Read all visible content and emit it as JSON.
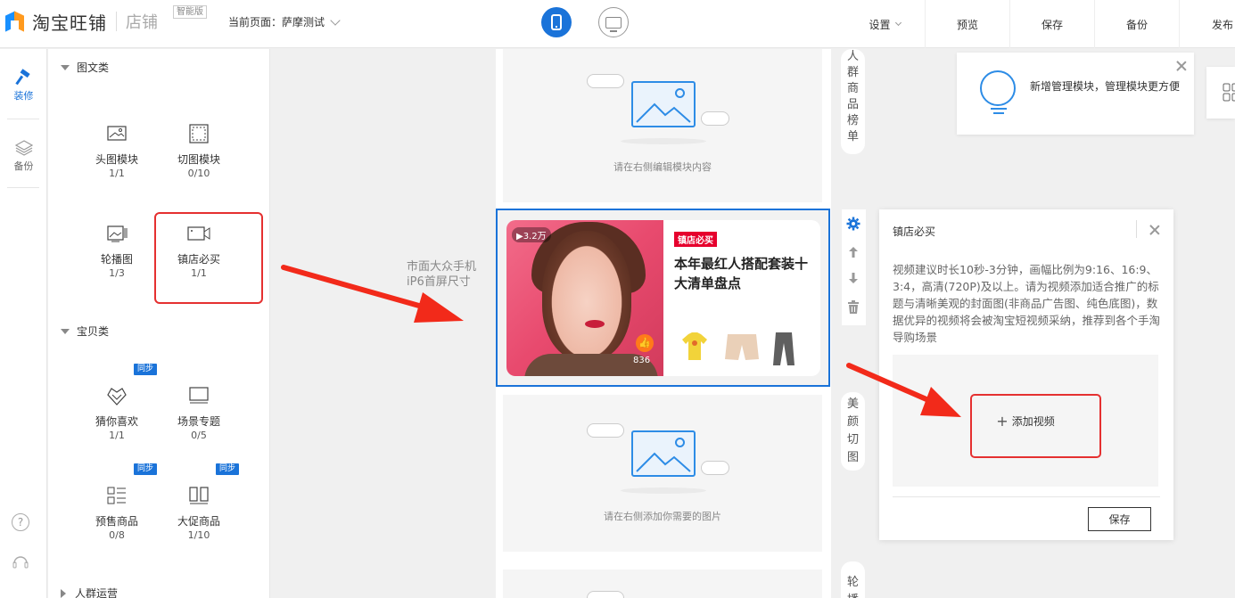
{
  "header": {
    "logo_text": "淘宝旺铺",
    "logo_sub": "店铺",
    "logo_badge": "智能版",
    "current_page_label": "当前页面：",
    "current_page_value": "萨摩测试",
    "actions": [
      "设置",
      "预览",
      "保存",
      "备份",
      "发布"
    ]
  },
  "leftnav": {
    "items": [
      {
        "label": "装修",
        "icon": "hammer-icon",
        "active": true
      },
      {
        "label": "备份",
        "icon": "layers-icon",
        "active": false
      }
    ],
    "bottom_icons": [
      "help-icon",
      "headset-icon"
    ]
  },
  "panel": {
    "sections": [
      {
        "title": "图文类",
        "expanded": true
      },
      {
        "title": "宝贝类",
        "expanded": true
      },
      {
        "title": "人群运营",
        "expanded": false
      }
    ],
    "modules": [
      {
        "name": "头图模块",
        "count": "1/1",
        "icon": "image-icon"
      },
      {
        "name": "切图模块",
        "count": "0/10",
        "icon": "crop-icon"
      },
      {
        "name": "轮播图",
        "count": "1/3",
        "icon": "carousel-icon"
      },
      {
        "name": "镇店必买",
        "count": "1/1",
        "icon": "video-icon"
      },
      {
        "name": "猜你喜欢",
        "count": "1/1",
        "icon": "heart-diamond-icon",
        "sync": "同步"
      },
      {
        "name": "场景专题",
        "count": "0/5",
        "icon": "monitor-icon"
      },
      {
        "name": "预售商品",
        "count": "0/8",
        "icon": "list-grid-icon",
        "sync": "同步"
      },
      {
        "name": "大促商品",
        "count": "1/10",
        "icon": "columns-icon",
        "sync": "同步"
      }
    ]
  },
  "canvas": {
    "label": "市面大众手机iP6首屏尺寸",
    "block1_placeholder": "请在右侧编辑模块内容",
    "block3_placeholder": "请在右侧添加你需要的图片",
    "video": {
      "views": "▶3.2万",
      "likes": "836",
      "tag": "镇店必买",
      "title": "本年最红人搭配套装十大清单盘点"
    }
  },
  "side_tabs": {
    "tab1": "人群商品榜单",
    "tab2": "美颜切图",
    "tab3": "轮播"
  },
  "tip": {
    "text": "新增管理模块，管理模块更方便"
  },
  "editor": {
    "title": "镇店必买",
    "description": "视频建议时长10秒-3分钟，画幅比例为9:16、16:9、3:4，高清(720P)及以上。请为视频添加适合推广的标题与清晰美观的封面图(非商品广告图、纯色底图)，数据优异的视频将会被淘宝短视频采纳，推荐到各个手淘导购场景",
    "add_video": "添加视频",
    "save": "保存"
  },
  "colors": {
    "primary": "#1a73d9",
    "highlight": "#e53030",
    "tag_red": "#e6002d"
  }
}
